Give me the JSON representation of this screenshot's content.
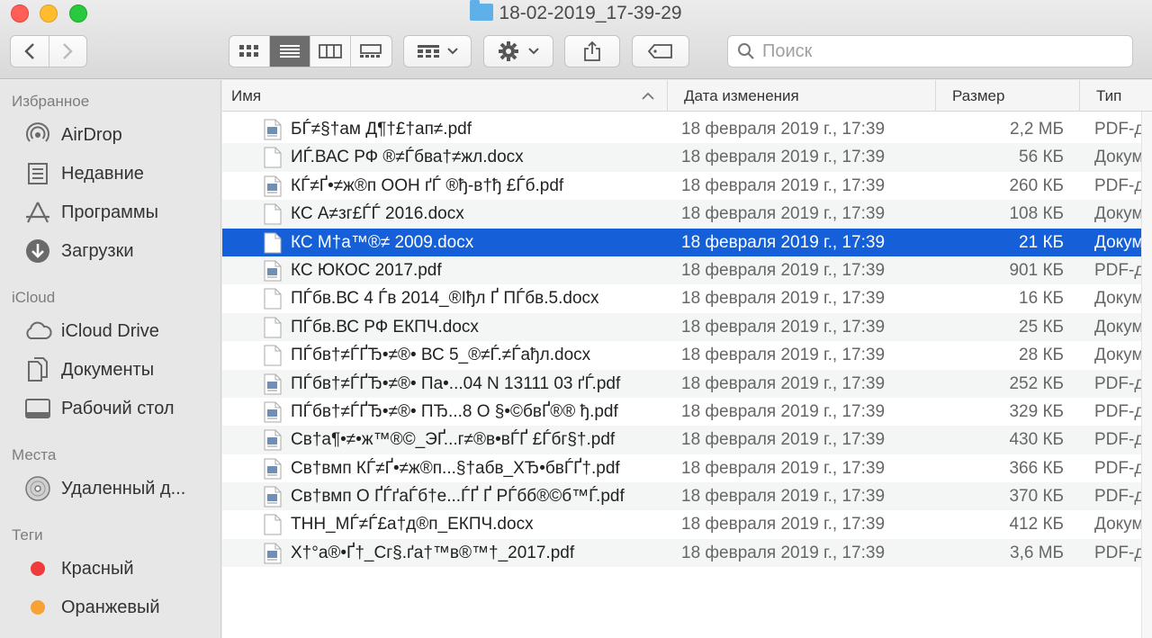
{
  "window": {
    "title": "18-02-2019_17-39-29"
  },
  "toolbar": {
    "back_icon": "chevron-left-icon",
    "forward_icon": "chevron-right-icon",
    "views": [
      "icons-view-icon",
      "list-view-icon",
      "columns-view-icon",
      "gallery-view-icon"
    ],
    "active_view": 1,
    "group_icon": "group-by-icon",
    "action_icon": "gear-icon",
    "share_icon": "share-icon",
    "tag_icon": "tag-icon",
    "search_placeholder": "Поиск"
  },
  "sidebar": {
    "favorites_label": "Избранное",
    "favorites": [
      {
        "label": "AirDrop",
        "icon": "airdrop-icon"
      },
      {
        "label": "Недавние",
        "icon": "recents-icon"
      },
      {
        "label": "Программы",
        "icon": "applications-icon"
      },
      {
        "label": "Загрузки",
        "icon": "downloads-icon"
      }
    ],
    "icloud_label": "iCloud",
    "icloud": [
      {
        "label": "iCloud Drive",
        "icon": "cloud-icon"
      },
      {
        "label": "Документы",
        "icon": "documents-icon"
      },
      {
        "label": "Рабочий стол",
        "icon": "desktop-icon"
      }
    ],
    "places_label": "Места",
    "places": [
      {
        "label": "Удаленный д...",
        "icon": "disc-icon"
      }
    ],
    "tags_label": "Теги",
    "tags": [
      {
        "label": "Красный",
        "color": "#ee3c3c"
      },
      {
        "label": "Оранжевый",
        "color": "#f7a237"
      }
    ]
  },
  "columns": {
    "name": "Имя",
    "date": "Дата изменения",
    "size": "Размер",
    "kind": "Тип"
  },
  "selected_index": 4,
  "files": [
    {
      "name": "БЃ≠§†ам Д¶†£†ап≠.pdf",
      "date": "18 февраля 2019 г., 17:39",
      "size": "2,2 МБ",
      "kind": "PDF-д",
      "type": "pdf"
    },
    {
      "name": "ИЃ.ВАС РФ ®≠Ѓбва†≠жл.docx",
      "date": "18 февраля 2019 г., 17:39",
      "size": "56 КБ",
      "kind": "Докум",
      "type": "doc"
    },
    {
      "name": "КЃ≠Ґ•≠ж®п ООН ґЃ ®ђ-в†ђ £Ѓб.pdf",
      "date": "18 февраля 2019 г., 17:39",
      "size": "260 КБ",
      "kind": "PDF-д",
      "type": "pdf"
    },
    {
      "name": "КС А≠зг£ЃЃ 2016.docx",
      "date": "18 февраля 2019 г., 17:39",
      "size": "108 КБ",
      "kind": "Докум",
      "type": "doc"
    },
    {
      "name": "КС М†а™®≠ 2009.docx",
      "date": "18 февраля 2019 г., 17:39",
      "size": "21 КБ",
      "kind": "Докум",
      "type": "doc"
    },
    {
      "name": "КС ЮКОС 2017.pdf",
      "date": "18 февраля 2019 г., 17:39",
      "size": "901 КБ",
      "kind": "PDF-д",
      "type": "pdf"
    },
    {
      "name": "ПЃбв.ВС 4 Ѓв 2014_®Іђл Ґ ПЃбв.5.docx",
      "date": "18 февраля 2019 г., 17:39",
      "size": "16 КБ",
      "kind": "Докум",
      "type": "doc"
    },
    {
      "name": "ПЃбв.ВС РФ ЕКПЧ.docx",
      "date": "18 февраля 2019 г., 17:39",
      "size": "25 КБ",
      "kind": "Докум",
      "type": "doc"
    },
    {
      "name": "ПЃбв†≠ЃҐЂ•≠®• ВС 5_®≠Ѓ.≠Ѓађл.docx",
      "date": "18 февраля 2019 г., 17:39",
      "size": "28 КБ",
      "kind": "Докум",
      "type": "doc"
    },
    {
      "name": "ПЃбв†≠ЃҐЂ•≠®• Па•...04 N 13111 03 ґЃ.pdf",
      "date": "18 февраля 2019 г., 17:39",
      "size": "252 КБ",
      "kind": "PDF-д",
      "type": "pdf"
    },
    {
      "name": "ПЃбв†≠ЃҐЂ•≠®• ПЂ...8  О §•©бвҐ®® ђ.pdf",
      "date": "18 февраля 2019 г., 17:39",
      "size": "329 КБ",
      "kind": "PDF-д",
      "type": "pdf"
    },
    {
      "name": "Св†а¶•≠•ж™®©_ЭҐ...г≠®в•вЃҐ £Ѓбг§†.pdf",
      "date": "18 февраля 2019 г., 17:39",
      "size": "430 КБ",
      "kind": "PDF-д",
      "type": "pdf"
    },
    {
      "name": "Св†вмп  КЃ≠Ґ•≠ж®п...§†абв_ХЂ•бвЃҐ†.pdf",
      "date": "18 февраля 2019 г., 17:39",
      "size": "366 КБ",
      "kind": "PDF-д",
      "type": "pdf"
    },
    {
      "name": "Св†вмп  О ҐЃґаЃб†е...ЃҐ Ґ РЃбб®©б™Ѓ.pdf",
      "date": "18 февраля 2019 г., 17:39",
      "size": "370 КБ",
      "kind": "PDF-д",
      "type": "pdf"
    },
    {
      "name": "ТНН_МЃ≠Ѓ£а†д®п_ЕКПЧ.docx",
      "date": "18 февраля 2019 г., 17:39",
      "size": "412 КБ",
      "kind": "Докум",
      "type": "doc"
    },
    {
      "name": "Х†°а®•Ґ†_Сг§.ґа†™в®™†_2017.pdf",
      "date": "18 февраля 2019 г., 17:39",
      "size": "3,6 МБ",
      "kind": "PDF-д",
      "type": "pdf"
    }
  ]
}
